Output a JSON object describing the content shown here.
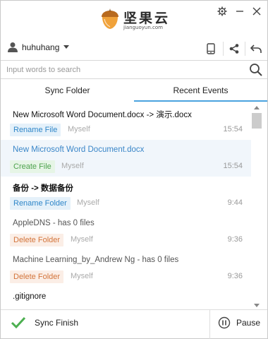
{
  "app": {
    "logo_text": "坚果云",
    "logo_sub": "jianguoyun.com"
  },
  "user": {
    "name": "huhuhang"
  },
  "search": {
    "placeholder": "Input words to search",
    "value": ""
  },
  "tabs": [
    {
      "label": "Sync Folder",
      "active": false
    },
    {
      "label": "Recent Events",
      "active": true
    }
  ],
  "events": [
    {
      "title": "New Microsoft Word Document.docx -> 演示.docx",
      "action": "Rename File",
      "who": "Myself",
      "time": "15:54"
    },
    {
      "title": "New Microsoft Word Document.docx",
      "action": "Create File",
      "who": "Myself",
      "time": "15:54"
    },
    {
      "title": "备份 -> 数据备份",
      "action": "Rename Folder",
      "who": "Myself",
      "time": "9:44"
    },
    {
      "title": "AppleDNS - has 0 files",
      "action": "Delete Folder",
      "who": "Myself",
      "time": "9:36"
    },
    {
      "title": "Machine Learning_by_Andrew Ng - has 0 files",
      "action": "Delete Folder",
      "who": "Myself",
      "time": "9:36"
    },
    {
      "title": ".gitignore",
      "action": "",
      "who": "",
      "time": ""
    }
  ],
  "footer": {
    "status": "Sync Finish",
    "pause_label": "Pause"
  },
  "colors": {
    "accent": "#4aa3df",
    "rename": "#2f86c8",
    "create": "#4da24d",
    "delete": "#d3743b",
    "check": "#4caf50"
  }
}
